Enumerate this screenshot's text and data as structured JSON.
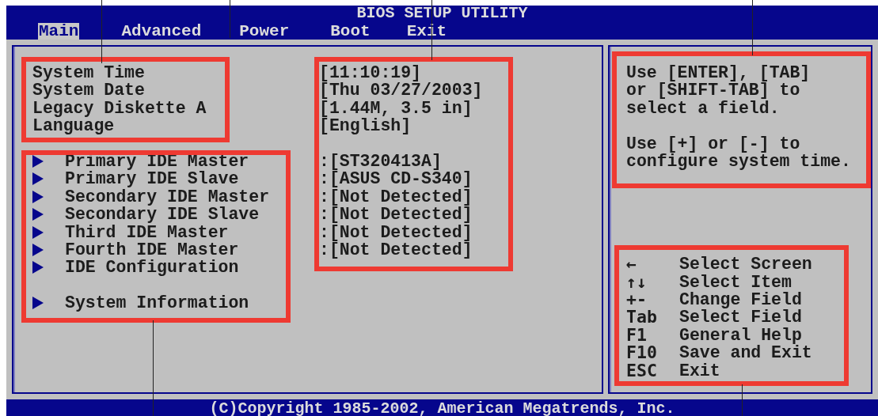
{
  "title": "BIOS SETUP UTILITY",
  "tabs": [
    {
      "label": "Main",
      "selected": true
    },
    {
      "label": "Advanced",
      "selected": false
    },
    {
      "label": "Power",
      "selected": false
    },
    {
      "label": "Boot",
      "selected": false
    },
    {
      "label": "Exit",
      "selected": false
    }
  ],
  "fields": [
    {
      "label": "System Time",
      "value": "[11:10:19]"
    },
    {
      "label": "System Date",
      "value": "[Thu 03/27/2003]"
    },
    {
      "label": "Legacy Diskette A",
      "value": "[1.44M, 3.5 in]"
    },
    {
      "label": "Language",
      "value": "[English]"
    }
  ],
  "submenus": [
    {
      "label": "Primary IDE Master",
      "value": ":[ST320413A]"
    },
    {
      "label": "Primary IDE Slave",
      "value": ":[ASUS CD-S340]"
    },
    {
      "label": "Secondary IDE Master",
      "value": ":[Not Detected]"
    },
    {
      "label": "Secondary IDE Slave",
      "value": ":[Not Detected]"
    },
    {
      "label": "Third IDE Master",
      "value": ":[Not Detected]"
    },
    {
      "label": "Fourth IDE Master",
      "value": ":[Not Detected]"
    },
    {
      "label": "IDE Configuration"
    }
  ],
  "more_submenus": [
    {
      "label": "System Information"
    }
  ],
  "help": [
    [
      "Use [ENTER], [TAB]",
      "or [SHIFT-TAB] to",
      "select a field."
    ],
    [
      "Use [+] or [-] to",
      "configure system time."
    ]
  ],
  "keys": [
    {
      "key": "←",
      "action": "Select Screen"
    },
    {
      "key": "↑↓",
      "action": "Select Item"
    },
    {
      "key": "+-",
      "action": "Change Field"
    },
    {
      "key": "Tab",
      "action": "Select Field"
    },
    {
      "key": "F1",
      "action": "General Help"
    },
    {
      "key": "F10",
      "action": "Save and Exit"
    },
    {
      "key": "ESC",
      "action": "Exit"
    }
  ],
  "footer": "(C)Copyright 1985-2002, American Megatrends, Inc."
}
